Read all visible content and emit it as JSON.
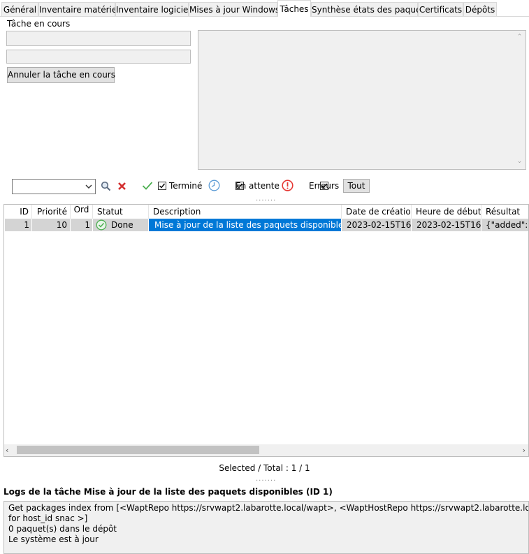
{
  "tabs": [
    {
      "label": "Général"
    },
    {
      "label": "Inventaire matériel"
    },
    {
      "label": "Inventaire logiciel"
    },
    {
      "label": "Mises à jour Windows"
    },
    {
      "label": "Tâches"
    },
    {
      "label": "Synthèse états des paquets"
    },
    {
      "label": "Certificats"
    },
    {
      "label": "Dépôts"
    }
  ],
  "current_task": {
    "label": "Tâche en cours",
    "cancel_button": "Annuler la tâche en cours"
  },
  "filters": {
    "done_label": "Terminé",
    "pending_label": "En attente",
    "errors_label": "Erreurs",
    "all_button": "Tout"
  },
  "grid": {
    "columns": [
      "ID",
      "Priorité",
      "Ord",
      "Statut",
      "Description",
      "Date de création",
      "Heure de début",
      "Résultat"
    ],
    "rows": [
      {
        "id": "1",
        "priority": "10",
        "ord": "1",
        "status": "Done",
        "description": "Mise à jour de la liste des paquets disponibles",
        "created": "2023-02-15T16...",
        "start": "2023-02-15T16...",
        "result": "{\"added\":[]"
      }
    ]
  },
  "status_bar": "Selected / Total : 1 / 1",
  "logs": {
    "title": "Logs de la tâche Mise à jour de la liste des paquets disponibles (ID 1)",
    "lines": [
      "Get packages index from [<WaptRepo https://srvwapt2.labarotte.local/wapt>, <WaptHostRepo https://srvwapt2.labarotte.local/wapt-host",
      "for host_id snac >]",
      "0 paquet(s) dans le dépôt",
      "Le système est à jour"
    ]
  },
  "colors": {
    "selection": "#0078d7",
    "row_bg": "#d4d4d4",
    "done_icon": "#4caf50",
    "error_icon": "#e53935",
    "clock_icon": "#5b9bd5"
  }
}
